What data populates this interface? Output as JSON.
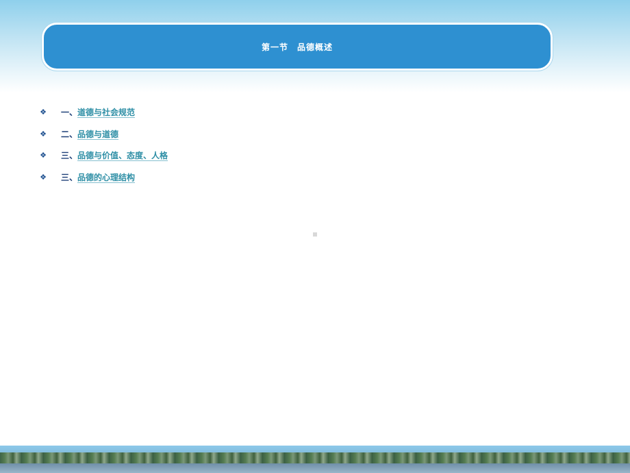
{
  "slide": {
    "title": "第一节　品德概述"
  },
  "outline": {
    "items": [
      {
        "bullet": "❖",
        "prefix": "一、",
        "label": "道德与社会规范"
      },
      {
        "bullet": "❖",
        "prefix": "二、",
        "label": "品德与道德"
      },
      {
        "bullet": "❖",
        "prefix": "三、",
        "label": "品德与价值、态度、人格"
      },
      {
        "bullet": "❖",
        "prefix": "三、",
        "label": "品德的心理结构"
      }
    ]
  },
  "colors": {
    "banner": "#2e90d1",
    "bullet": "#1d4f8f",
    "prefix": "#1d3f78",
    "link": "#2f8fa6",
    "sky": "#8fd0ec"
  },
  "icons": {
    "bullet": "diamond-bullet-icon"
  }
}
